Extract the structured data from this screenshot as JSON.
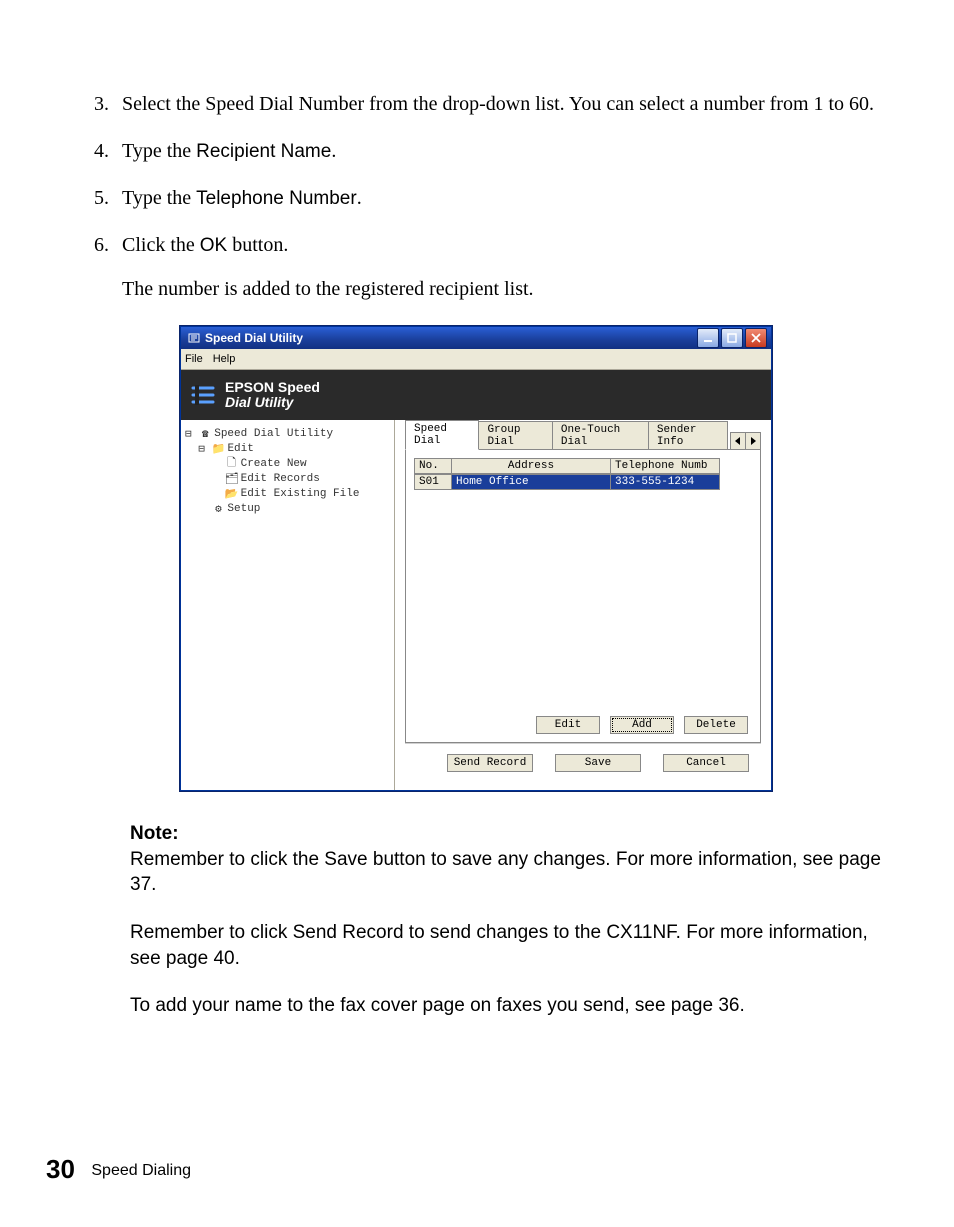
{
  "steps": {
    "s3a": "Select the Speed Dial Number from the drop-down list. You can select a number from 1 to 60.",
    "s4a": "Type the ",
    "s4b": "Recipient Name",
    "s4c": ".",
    "s5a": "Type the ",
    "s5b": "Telephone Number",
    "s5c": ".",
    "s6a": "Click the ",
    "s6b": "OK",
    "s6c": " button."
  },
  "after": "The number is added to the registered recipient list.",
  "win": {
    "title": "Speed Dial Utility",
    "menu": {
      "file": "File",
      "help": "Help"
    },
    "brand1": "EPSON Speed",
    "brand2": "Dial Utility",
    "tree": {
      "root": "Speed Dial Utility",
      "edit": "Edit",
      "create": "Create New",
      "records": "Edit Records",
      "existing": "Edit Existing File",
      "setup": "Setup"
    },
    "tabs": {
      "t1": "Speed Dial",
      "t2": "Group Dial",
      "t3": "One-Touch Dial",
      "t4": "Sender Info"
    },
    "grid": {
      "h1": "No.",
      "h2": "Address",
      "h3": "Telephone Numb",
      "r1c1": "S01",
      "r1c2": "Home Office",
      "r1c3": "333-555-1234"
    },
    "btns": {
      "edit": "Edit",
      "add": "Add",
      "delete": "Delete",
      "send": "Send Record",
      "save": "Save",
      "cancel": "Cancel"
    }
  },
  "note": {
    "heading": "Note:",
    "p1a": "Remember to click the ",
    "p1b": "Save",
    "p1c": " button to save any changes. For more information, see page 37.",
    "p2a": "Remember to click ",
    "p2b": "Send Record",
    "p2c": " to send changes to the CX11NF. For more information, see page 40.",
    "p3": "To add your name to the fax cover page on faxes you send, see page 36."
  },
  "footer": {
    "page": "30",
    "section": "Speed Dialing"
  }
}
